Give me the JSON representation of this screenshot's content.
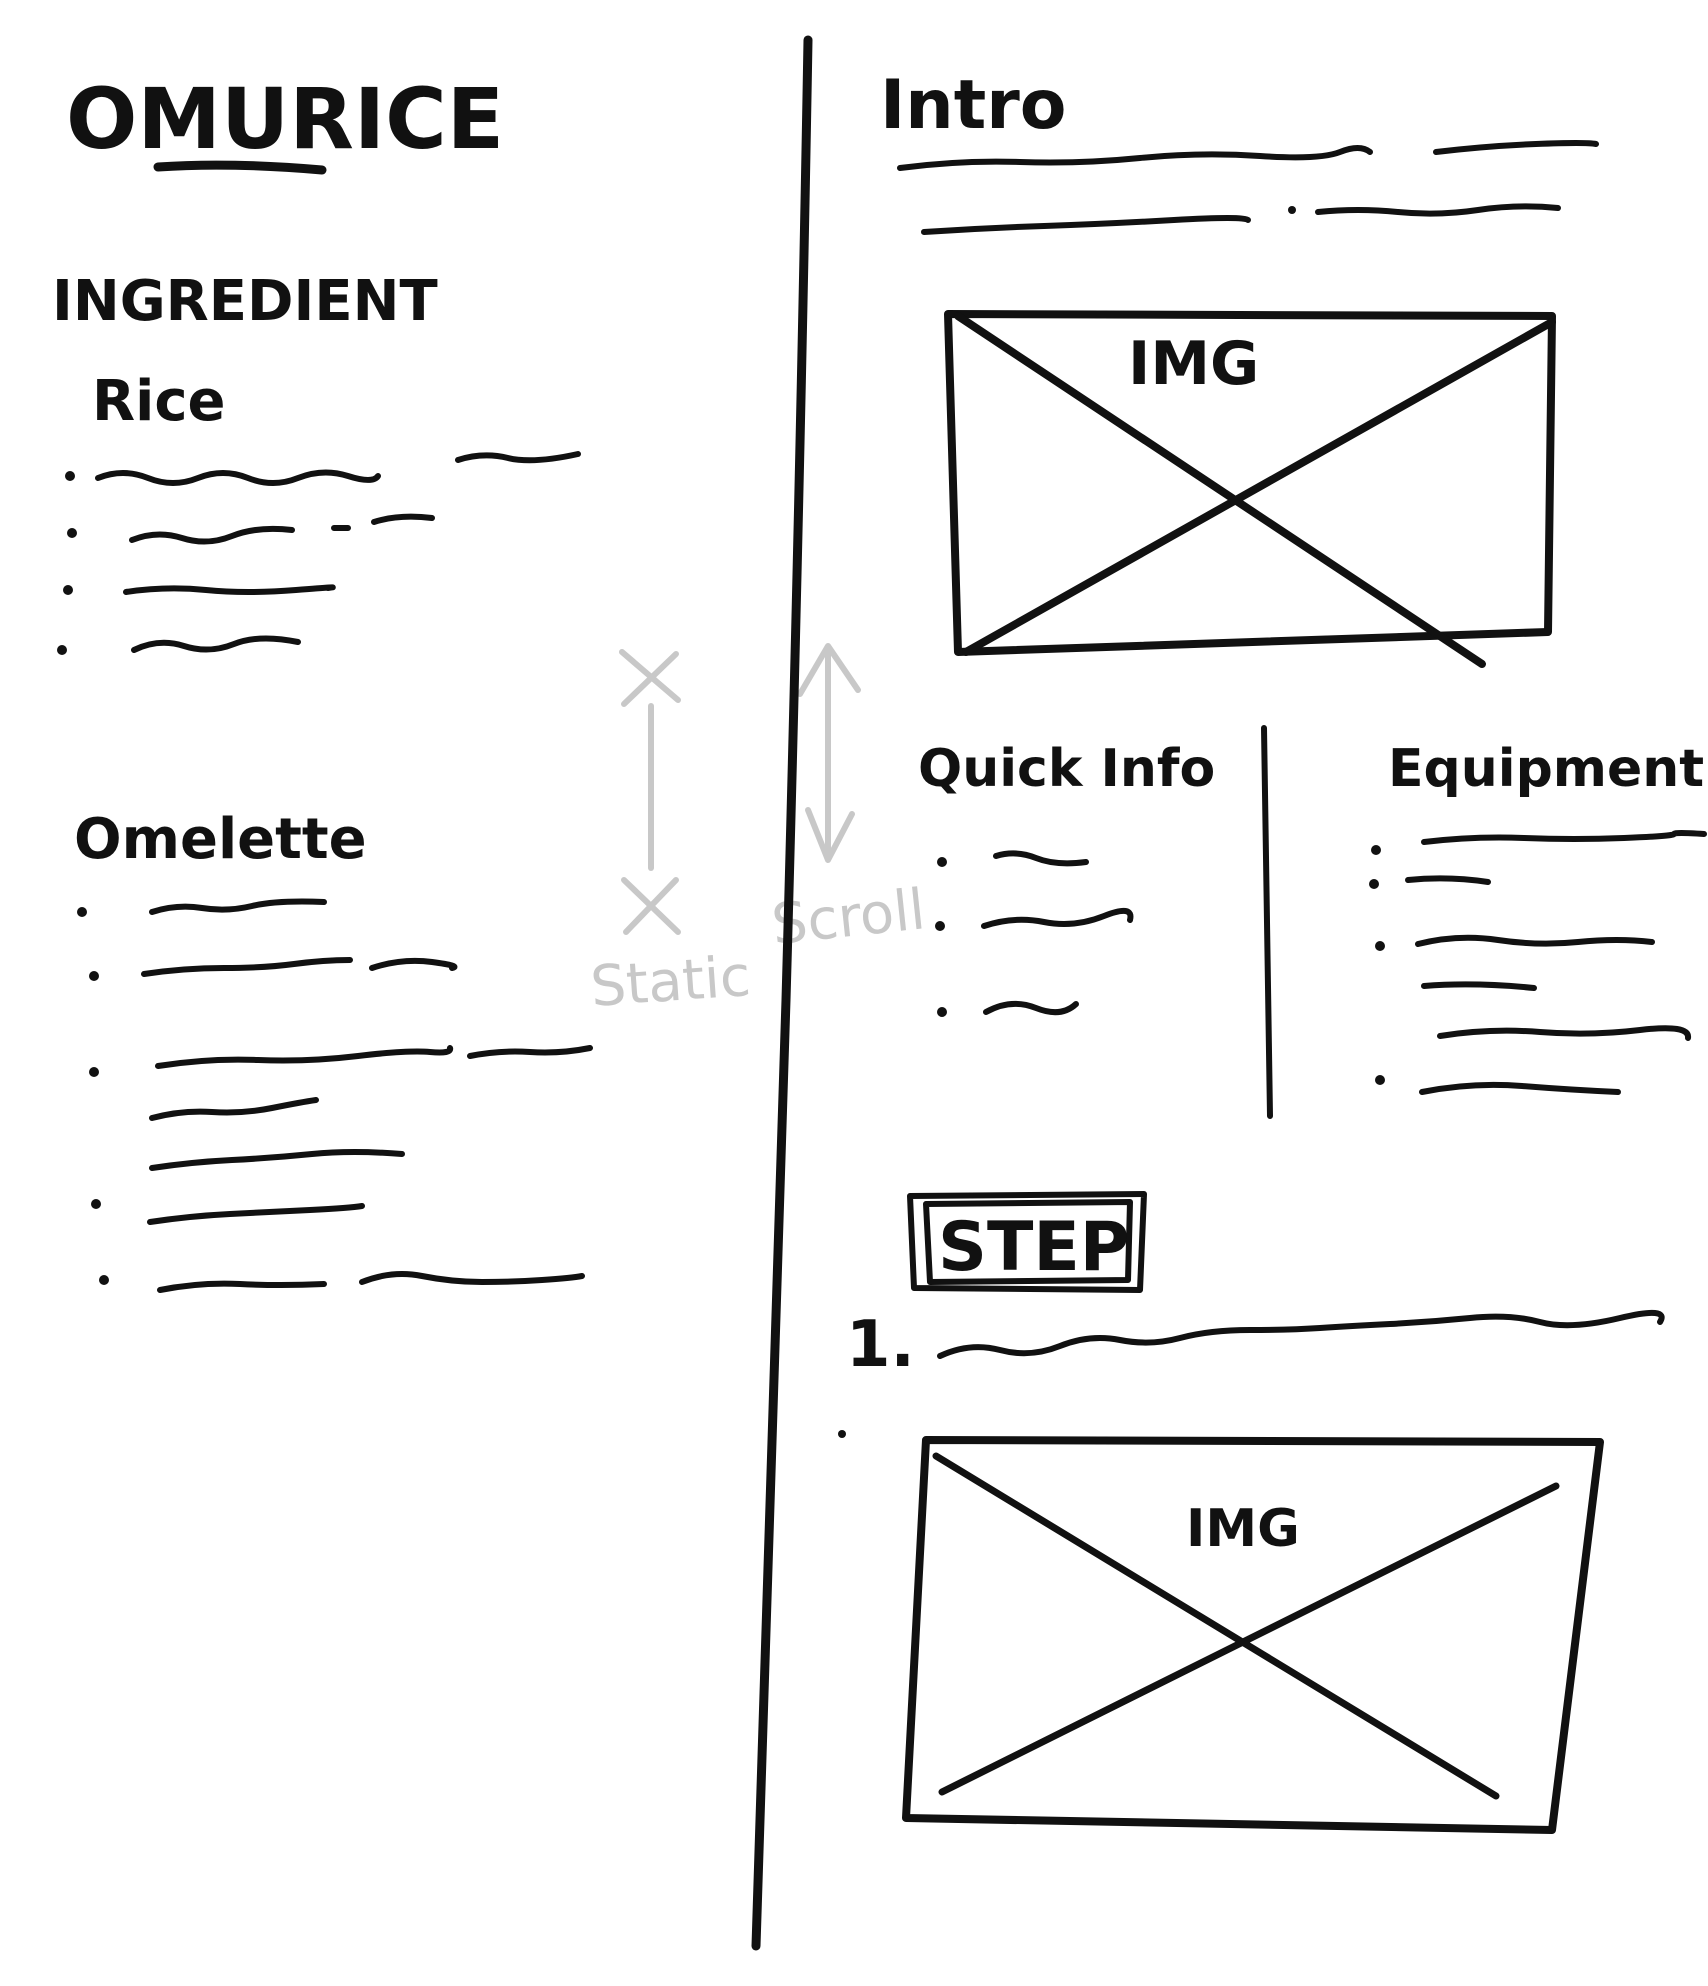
{
  "left_panel": {
    "title": "OMURICE",
    "ingredients_heading": "INGREDIENT",
    "rice_heading": "Rice",
    "omelette_heading": "Omelette",
    "static_label": "Static"
  },
  "right_panel": {
    "scroll_label": "Scroll",
    "intro_heading": "Intro",
    "hero_image_label": "IMG",
    "quick_info_heading": "Quick Info",
    "equipment_heading": "Equipment",
    "step_heading": "STEP",
    "step_number": "1.",
    "step_image_label": "IMG"
  },
  "colors": {
    "ink": "#111111",
    "pencil": "#c8c8c8",
    "paper": "#ffffff"
  }
}
